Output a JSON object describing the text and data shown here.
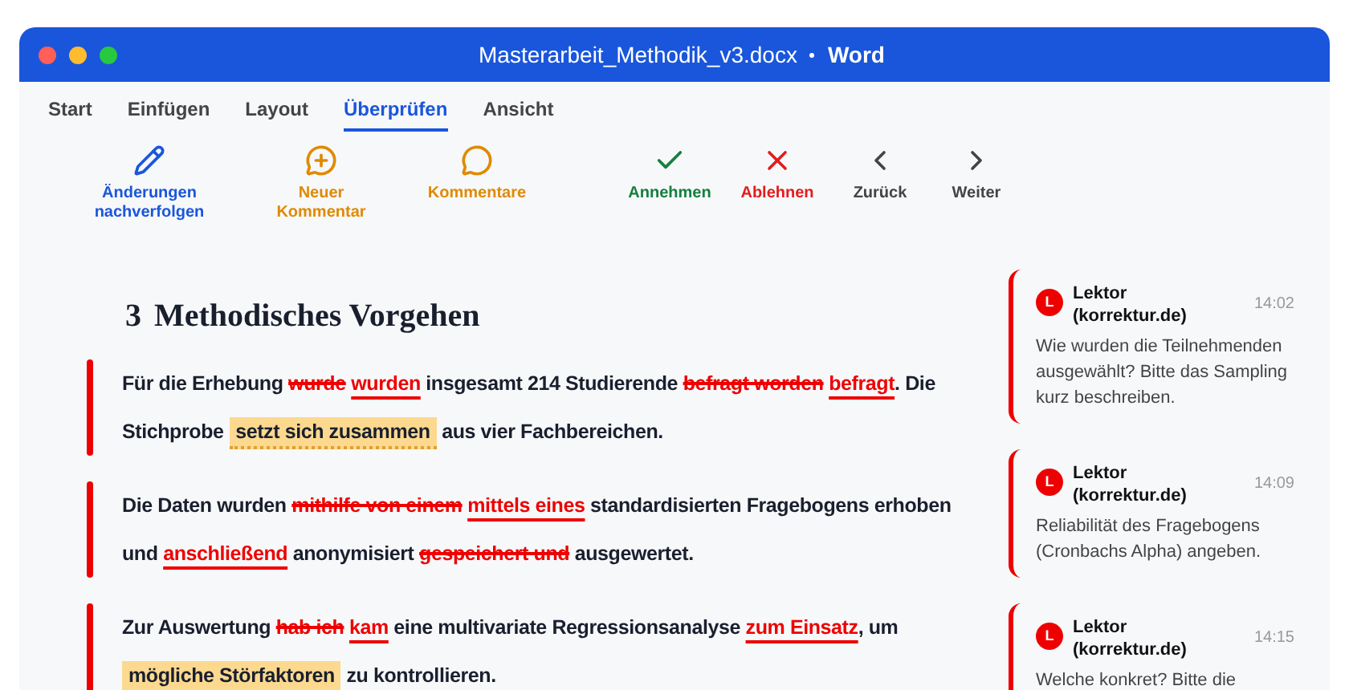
{
  "window": {
    "title": "Masterarbeit_Methodik_v3.docx",
    "app": "Word"
  },
  "tabs": [
    {
      "label": "Start",
      "selected": false
    },
    {
      "label": "Einfügen",
      "selected": false
    },
    {
      "label": "Layout",
      "selected": false
    },
    {
      "label": "Überprüfen",
      "selected": true
    },
    {
      "label": "Ansicht",
      "selected": false
    }
  ],
  "toolbar": [
    {
      "kind": "track",
      "label": "Änderungen nachverfolgen"
    },
    {
      "kind": "new-comment",
      "label": "Neuer Kommentar"
    },
    {
      "kind": "comments",
      "label": "Kommentare"
    },
    {
      "kind": "accept",
      "label": "Annehmen"
    },
    {
      "kind": "reject",
      "label": "Ablehnen"
    },
    {
      "kind": "prev",
      "label": "Zurück"
    },
    {
      "kind": "next",
      "label": "Weiter"
    }
  ],
  "document": {
    "heading_number": "3",
    "heading": "Methodisches Vorgehen",
    "paragraphs": [
      [
        {
          "kind": "text",
          "text": "Für die Erhebung "
        },
        {
          "kind": "deleted",
          "text": "wurde"
        },
        {
          "kind": "inserted",
          "text": "wurden"
        },
        {
          "kind": "text",
          "text": " insgesamt 214 Studierende "
        },
        {
          "kind": "deleted",
          "text": "befragt worden"
        },
        {
          "kind": "inserted",
          "text": "befragt"
        },
        {
          "kind": "text",
          "text": ". Die Stichprobe "
        },
        {
          "kind": "commented",
          "text": "setzt sich zusammen"
        },
        {
          "kind": "text",
          "text": " aus vier Fachbereichen."
        }
      ],
      [
        {
          "kind": "text",
          "text": "Die Daten wurden "
        },
        {
          "kind": "deleted",
          "text": "mithilfe von einem"
        },
        {
          "kind": "inserted",
          "text": "mittels eines"
        },
        {
          "kind": "text",
          "text": " standardisierten Fragebogens erhoben und "
        },
        {
          "kind": "inserted",
          "text": "anschließend"
        },
        {
          "kind": "text",
          "text": " anonymisiert "
        },
        {
          "kind": "deleted",
          "text": "gespeichert und"
        },
        {
          "kind": "text",
          "text": " ausgewertet."
        }
      ],
      [
        {
          "kind": "text",
          "text": "Zur Auswertung "
        },
        {
          "kind": "deleted",
          "text": "hab ich"
        },
        {
          "kind": "inserted",
          "text": "kam"
        },
        {
          "kind": "text",
          "text": " eine multivariate Regressionsanalyse "
        },
        {
          "kind": "inserted",
          "text": "zum Einsatz"
        },
        {
          "kind": "text",
          "text": ", um "
        },
        {
          "kind": "commented",
          "text": "mögliche Störfaktoren"
        },
        {
          "kind": "text",
          "text": " zu kontrollieren."
        }
      ]
    ]
  },
  "comments": [
    {
      "avatar": "L",
      "author": "Lektor (korrektur.de)",
      "time": "14:02",
      "text": "Wie wurden die Teilnehmenden ausgewählt? Bitte das Sampling kurz beschreiben."
    },
    {
      "avatar": "L",
      "author": "Lektor (korrektur.de)",
      "time": "14:09",
      "text": "Reliabilität des Fragebogens (Cronbachs Alpha) angeben."
    },
    {
      "avatar": "L",
      "author": "Lektor (korrektur.de)",
      "time": "14:15",
      "text": "Welche konkret? Bitte die"
    }
  ]
}
